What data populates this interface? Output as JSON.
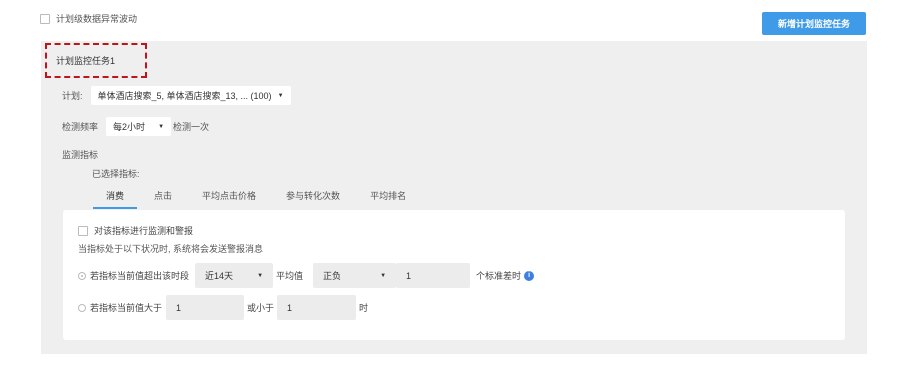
{
  "top": {
    "anomaly_checkbox_label": "计划级数据异常波动",
    "add_task_button": "新增计划监控任务"
  },
  "task": {
    "title": "计划监控任务1",
    "plan_label": "计划:",
    "plan_value": "单体酒店搜索_5,  单体酒店搜索_13, ... (100)",
    "freq_label": "检测频率",
    "freq_value": "每2小时",
    "freq_suffix": "检测一次",
    "metric_label": "监测指标",
    "selected_label": "已选择指标:"
  },
  "tabs": [
    "消费",
    "点击",
    "平均点击价格",
    "参与转化次数",
    "平均排名"
  ],
  "card": {
    "monitor_checkbox_label": "对该指标进行监测和警报",
    "desc": "当指标处于以下状况时, 系统将会发送警报消息",
    "rule1": {
      "prefix": "若指标当前值超出该时段",
      "period": "近14天",
      "avg_label": "平均值",
      "direction": "正负",
      "multiplier": "1",
      "suffix": "个标准差时"
    },
    "rule2": {
      "prefix": "若指标当前值大于",
      "gt_value": "1",
      "mid": "或小于",
      "lt_value": "1",
      "suffix": "时"
    }
  },
  "colors": {
    "accent": "#3f9ae8",
    "highlight_dashed": "#c0141c",
    "panel_bg": "#efefef"
  },
  "icons": {
    "info": "info-circle-icon",
    "caret": "caret-down-icon"
  }
}
